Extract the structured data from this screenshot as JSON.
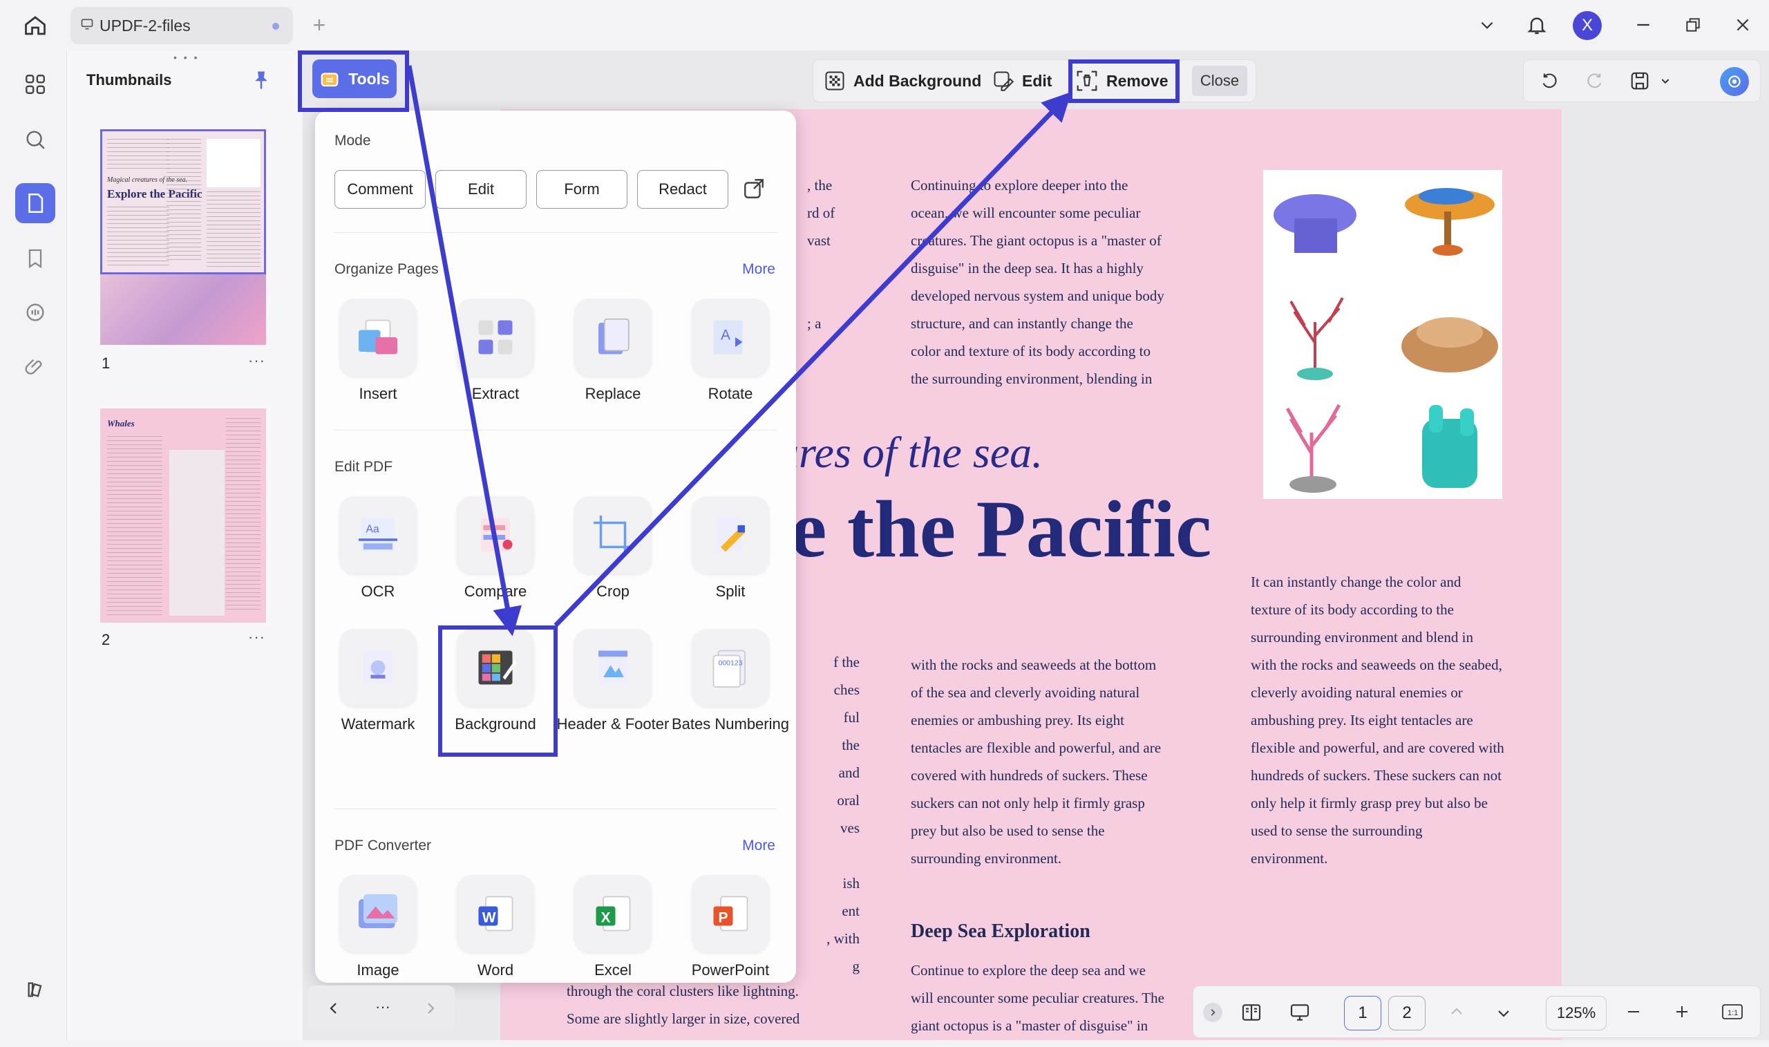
{
  "tab": {
    "title": "UPDF-2-files"
  },
  "user": {
    "avatar_initial": "X"
  },
  "thumbnails": {
    "title": "Thumbnails",
    "pages": [
      {
        "number": "1",
        "more": "···"
      },
      {
        "number": "2",
        "more": "···"
      }
    ]
  },
  "tools_button": {
    "label": "Tools"
  },
  "background_toolbar": {
    "add": "Add Background",
    "edit": "Edit",
    "remove": "Remove",
    "close": "Close"
  },
  "tools_panel": {
    "mode": {
      "title": "Mode",
      "buttons": [
        "Comment",
        "Edit",
        "Form",
        "Redact"
      ]
    },
    "organize": {
      "title": "Organize Pages",
      "more": "More",
      "items": [
        "Insert",
        "Extract",
        "Replace",
        "Rotate"
      ]
    },
    "edit_pdf": {
      "title": "Edit PDF",
      "items": [
        "OCR",
        "Compare",
        "Crop",
        "Split",
        "Watermark",
        "Background",
        "Header & Footer",
        "Bates Numbering"
      ]
    },
    "converter": {
      "title": "PDF Converter",
      "more": "More",
      "items": [
        "Image",
        "Word",
        "Excel",
        "PowerPoint"
      ]
    }
  },
  "bottom_bar": {
    "page1": "1",
    "page2": "2",
    "zoom": "125%"
  },
  "page_nav": {
    "more": "···"
  },
  "document": {
    "heading_italic": "ures of the sea.",
    "heading_big": "e the Pacific",
    "subheading": "Deep Sea Exploration",
    "left_fragments_top": [
      ", the",
      "rd of",
      "vast",
      "",
      "",
      "; a"
    ],
    "left_fragments_mid": [
      "f the",
      "ches",
      "ful",
      "the",
      "and",
      "oral",
      "ves",
      "",
      "ish",
      "ent",
      ", with",
      "g"
    ],
    "left_bottom": [
      "through the coral clusters like lightning.",
      "Some are slightly larger in size, covered"
    ],
    "col_mid_top": [
      "Continuing to explore deeper into the",
      "ocean, we will encounter some peculiar",
      "creatures. The giant octopus is a \"master of",
      "disguise\" in the deep sea. It has a highly",
      "developed nervous system and unique body",
      "structure, and can instantly change the",
      "color and texture of its body according to",
      "the surrounding environment, blending in"
    ],
    "col_mid_bottom": [
      "with the rocks and seaweeds at the bottom",
      "of the sea and cleverly avoiding natural",
      "enemies or ambushing prey. Its eight",
      "tentacles are flexible and powerful, and are",
      "covered with hundreds of suckers. These",
      "suckers can not only help it firmly grasp",
      "prey but also be used to sense the",
      "surrounding environment."
    ],
    "col_mid_end": [
      "Continue to explore the deep sea and we",
      "will encounter some peculiar creatures. The",
      "giant octopus is a \"master of disguise\" in"
    ],
    "col_right": [
      "It can instantly change the color and",
      "texture of its body according to the",
      "surrounding environment and blend in",
      "with the rocks and seaweeds on the seabed,",
      "cleverly avoiding natural enemies or",
      "ambushing prey. Its eight tentacles are",
      "flexible and powerful, and are covered with",
      "hundreds of suckers. These suckers can not",
      "only help it firmly grasp prey but also be",
      "used to sense the surrounding",
      "environment."
    ]
  },
  "thumb1_text": {
    "italic": "Magical creatures of the sea.",
    "title": "Explore the Pacific"
  },
  "thumb2_text": {
    "title": "Whales"
  },
  "colors": {
    "accent": "#5b6ee8",
    "highlight": "#3d3ccf",
    "page_bg": "#f7cde0",
    "heading": "#232a7a"
  }
}
